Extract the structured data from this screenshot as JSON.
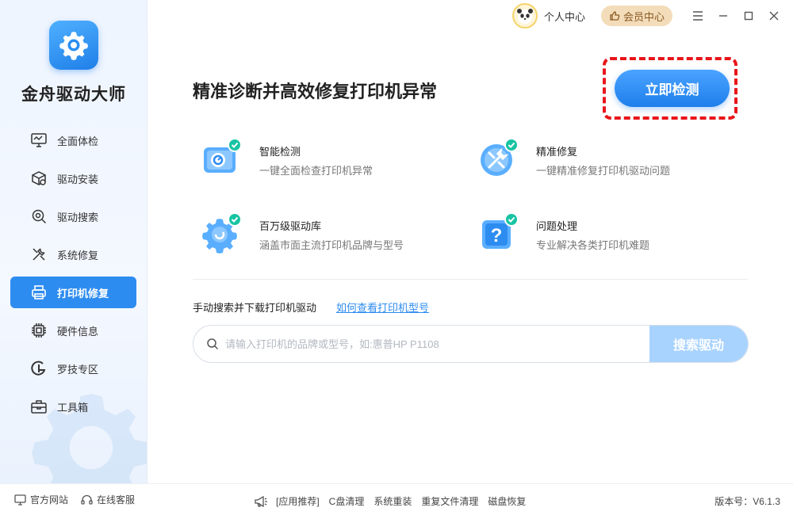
{
  "app": {
    "name": "金舟驱动大师",
    "brand_color": "#2d8cf0",
    "logo_icon": "gear-logo-icon"
  },
  "topbar": {
    "user_center": "个人中心",
    "vip_center": "会员中心"
  },
  "sidebar": {
    "items": [
      {
        "label": "全面体检",
        "icon": "monitor-check-icon",
        "active": false
      },
      {
        "label": "驱动安装",
        "icon": "package-gear-icon",
        "active": false
      },
      {
        "label": "驱动搜索",
        "icon": "search-gear-icon",
        "active": false
      },
      {
        "label": "系统修复",
        "icon": "wrench-screwdriver-icon",
        "active": false
      },
      {
        "label": "打印机修复",
        "icon": "printer-icon",
        "active": true
      },
      {
        "label": "硬件信息",
        "icon": "chip-icon",
        "active": false
      },
      {
        "label": "罗技专区",
        "icon": "logitech-icon",
        "active": false
      },
      {
        "label": "工具箱",
        "icon": "toolbox-icon",
        "active": false
      }
    ]
  },
  "main": {
    "headline": "精准诊断并高效修复打印机异常",
    "detect_button": "立即检测",
    "features": [
      {
        "title": "智能检测",
        "desc": "一键全面检查打印机异常",
        "icon": "smart-detect-icon"
      },
      {
        "title": "精准修复",
        "desc": "一键精准修复打印机驱动问题",
        "icon": "repair-tools-icon"
      },
      {
        "title": "百万级驱动库",
        "desc": "涵盖市面主流打印机品牌与型号",
        "icon": "driver-library-icon"
      },
      {
        "title": "问题处理",
        "desc": "专业解决各类打印机难题",
        "icon": "question-icon"
      }
    ],
    "manual_label": "手动搜索并下载打印机驱动",
    "howto_link": "如何查看打印机型号",
    "search": {
      "placeholder": "请输入打印机的品牌或型号，如:惠普HP P1108",
      "value": "",
      "button": "搜索驱动"
    }
  },
  "footer": {
    "official_site": "官方网站",
    "online_service": "在线客服",
    "recommend_label": "[应用推荐]",
    "recommend_apps": [
      "C盘清理",
      "系统重装",
      "重复文件清理",
      "磁盘恢复"
    ],
    "version": "版本号：V6.1.3"
  }
}
